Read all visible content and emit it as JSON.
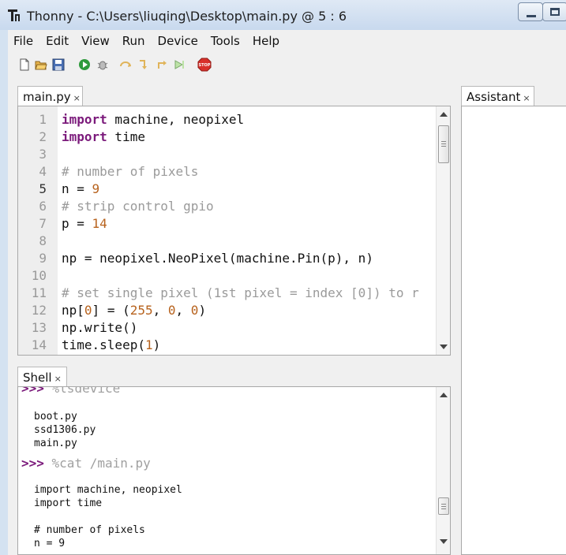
{
  "window": {
    "title": "Thonny  -  C:\\Users\\liuqing\\Desktop\\main.py  @  5 : 6"
  },
  "menu": [
    "File",
    "Edit",
    "View",
    "Run",
    "Device",
    "Tools",
    "Help"
  ],
  "toolbar": {
    "icons": [
      "new-file-icon",
      "open-file-icon",
      "save-icon",
      "run-icon",
      "debug-icon",
      "step-over-icon",
      "step-into-icon",
      "step-out-icon",
      "resume-icon",
      "stop-icon"
    ]
  },
  "editor": {
    "tab_label": "main.py",
    "tab_close": "×",
    "current_line": 5,
    "lines": [
      {
        "n": "1",
        "tokens": [
          {
            "t": "import",
            "c": "kw"
          },
          {
            "t": " machine, neopixel",
            "c": ""
          }
        ]
      },
      {
        "n": "2",
        "tokens": [
          {
            "t": "import",
            "c": "kw"
          },
          {
            "t": " time",
            "c": ""
          }
        ]
      },
      {
        "n": "3",
        "tokens": []
      },
      {
        "n": "4",
        "tokens": [
          {
            "t": "# number of pixels",
            "c": "cm"
          }
        ]
      },
      {
        "n": "5",
        "tokens": [
          {
            "t": "n = ",
            "c": ""
          },
          {
            "t": "9",
            "c": "num"
          }
        ]
      },
      {
        "n": "6",
        "tokens": [
          {
            "t": "# strip control gpio",
            "c": "cm"
          }
        ]
      },
      {
        "n": "7",
        "tokens": [
          {
            "t": "p = ",
            "c": ""
          },
          {
            "t": "14",
            "c": "num"
          }
        ]
      },
      {
        "n": "8",
        "tokens": []
      },
      {
        "n": "9",
        "tokens": [
          {
            "t": "np = neopixel.NeoPixel(machine.Pin(p), n)",
            "c": ""
          }
        ]
      },
      {
        "n": "10",
        "tokens": []
      },
      {
        "n": "11",
        "tokens": [
          {
            "t": "# set single pixel (1st pixel = index [0]) to r",
            "c": "cm"
          }
        ]
      },
      {
        "n": "12",
        "tokens": [
          {
            "t": "np[",
            "c": ""
          },
          {
            "t": "0",
            "c": "num"
          },
          {
            "t": "] = (",
            "c": ""
          },
          {
            "t": "255",
            "c": "num"
          },
          {
            "t": ", ",
            "c": ""
          },
          {
            "t": "0",
            "c": "num"
          },
          {
            "t": ", ",
            "c": ""
          },
          {
            "t": "0",
            "c": "num"
          },
          {
            "t": ")",
            "c": ""
          }
        ]
      },
      {
        "n": "13",
        "tokens": [
          {
            "t": "np.write()",
            "c": ""
          }
        ]
      },
      {
        "n": "14",
        "tokens": [
          {
            "t": "time.sleep(",
            "c": ""
          },
          {
            "t": "1",
            "c": "num"
          },
          {
            "t": ")",
            "c": ""
          }
        ]
      }
    ]
  },
  "shell": {
    "tab_label": "Shell",
    "tab_close": "×",
    "lines": [
      {
        "kind": "cmd",
        "prompt": ">>>",
        "text": " %lsdevice"
      },
      {
        "kind": "out",
        "text": "boot.py"
      },
      {
        "kind": "out",
        "text": "ssd1306.py"
      },
      {
        "kind": "out",
        "text": "main.py"
      },
      {
        "kind": "cmd",
        "prompt": ">>>",
        "text": " %cat /main.py"
      },
      {
        "kind": "out",
        "text": "import machine, neopixel"
      },
      {
        "kind": "out",
        "text": "import time"
      },
      {
        "kind": "out",
        "text": ""
      },
      {
        "kind": "out",
        "text": "# number of pixels"
      },
      {
        "kind": "out",
        "text": "n = 9"
      }
    ]
  },
  "assistant": {
    "tab_label": "Assistant",
    "tab_close": "×"
  }
}
